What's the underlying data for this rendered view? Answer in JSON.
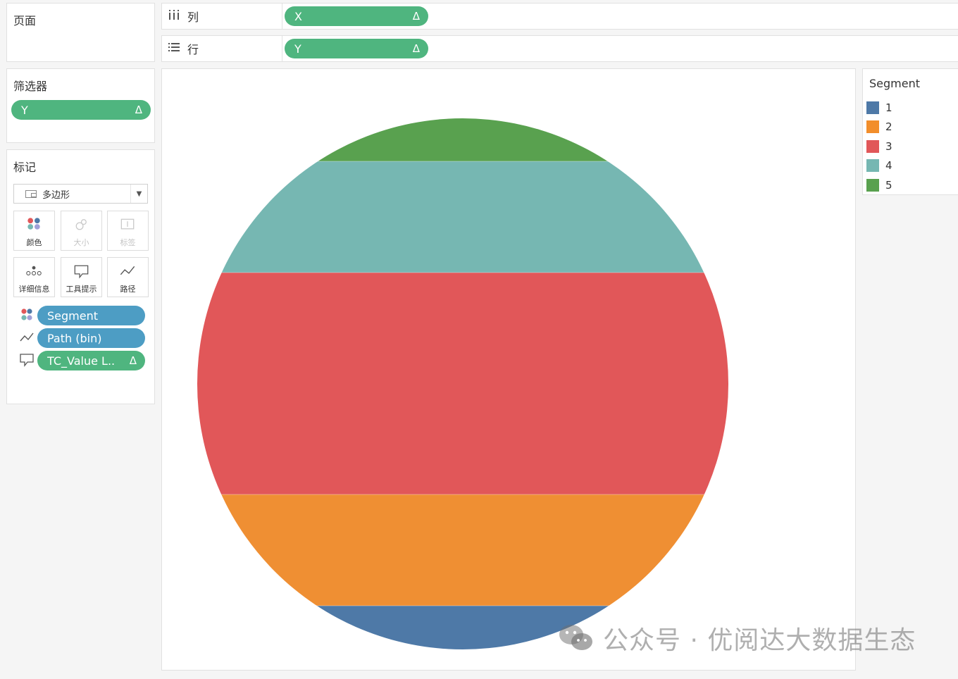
{
  "pages_panel": {
    "title": "页面"
  },
  "shelves": {
    "columns": {
      "label": "列",
      "pill": "X",
      "delta": "Δ"
    },
    "rows": {
      "label": "行",
      "pill": "Y",
      "delta": "Δ"
    }
  },
  "filters_panel": {
    "title": "筛选器",
    "pill": "Y",
    "delta": "Δ"
  },
  "marks_panel": {
    "title": "标记",
    "mark_type": "多边形",
    "buttons": {
      "color": "颜色",
      "size": "大小",
      "label": "标签",
      "detail": "详细信息",
      "tooltip": "工具提示",
      "path": "路径"
    },
    "fields": [
      {
        "text": "Segment",
        "type": "color"
      },
      {
        "text": "Path (bin)",
        "type": "path"
      },
      {
        "text": "TC_Value L..",
        "type": "tooltip",
        "delta": "Δ"
      }
    ]
  },
  "legend": {
    "title": "Segment",
    "items": [
      {
        "label": "1",
        "color": "#4e79a7"
      },
      {
        "label": "2",
        "color": "#f28e2b"
      },
      {
        "label": "3",
        "color": "#e15759"
      },
      {
        "label": "4",
        "color": "#76b7b2"
      },
      {
        "label": "5",
        "color": "#59a14f"
      }
    ]
  },
  "colors": {
    "pill_green": "#4fb57f",
    "pill_blue": "#4d9dc4"
  },
  "watermark": {
    "text": "公众号 · 优阅达大数据生态"
  }
}
